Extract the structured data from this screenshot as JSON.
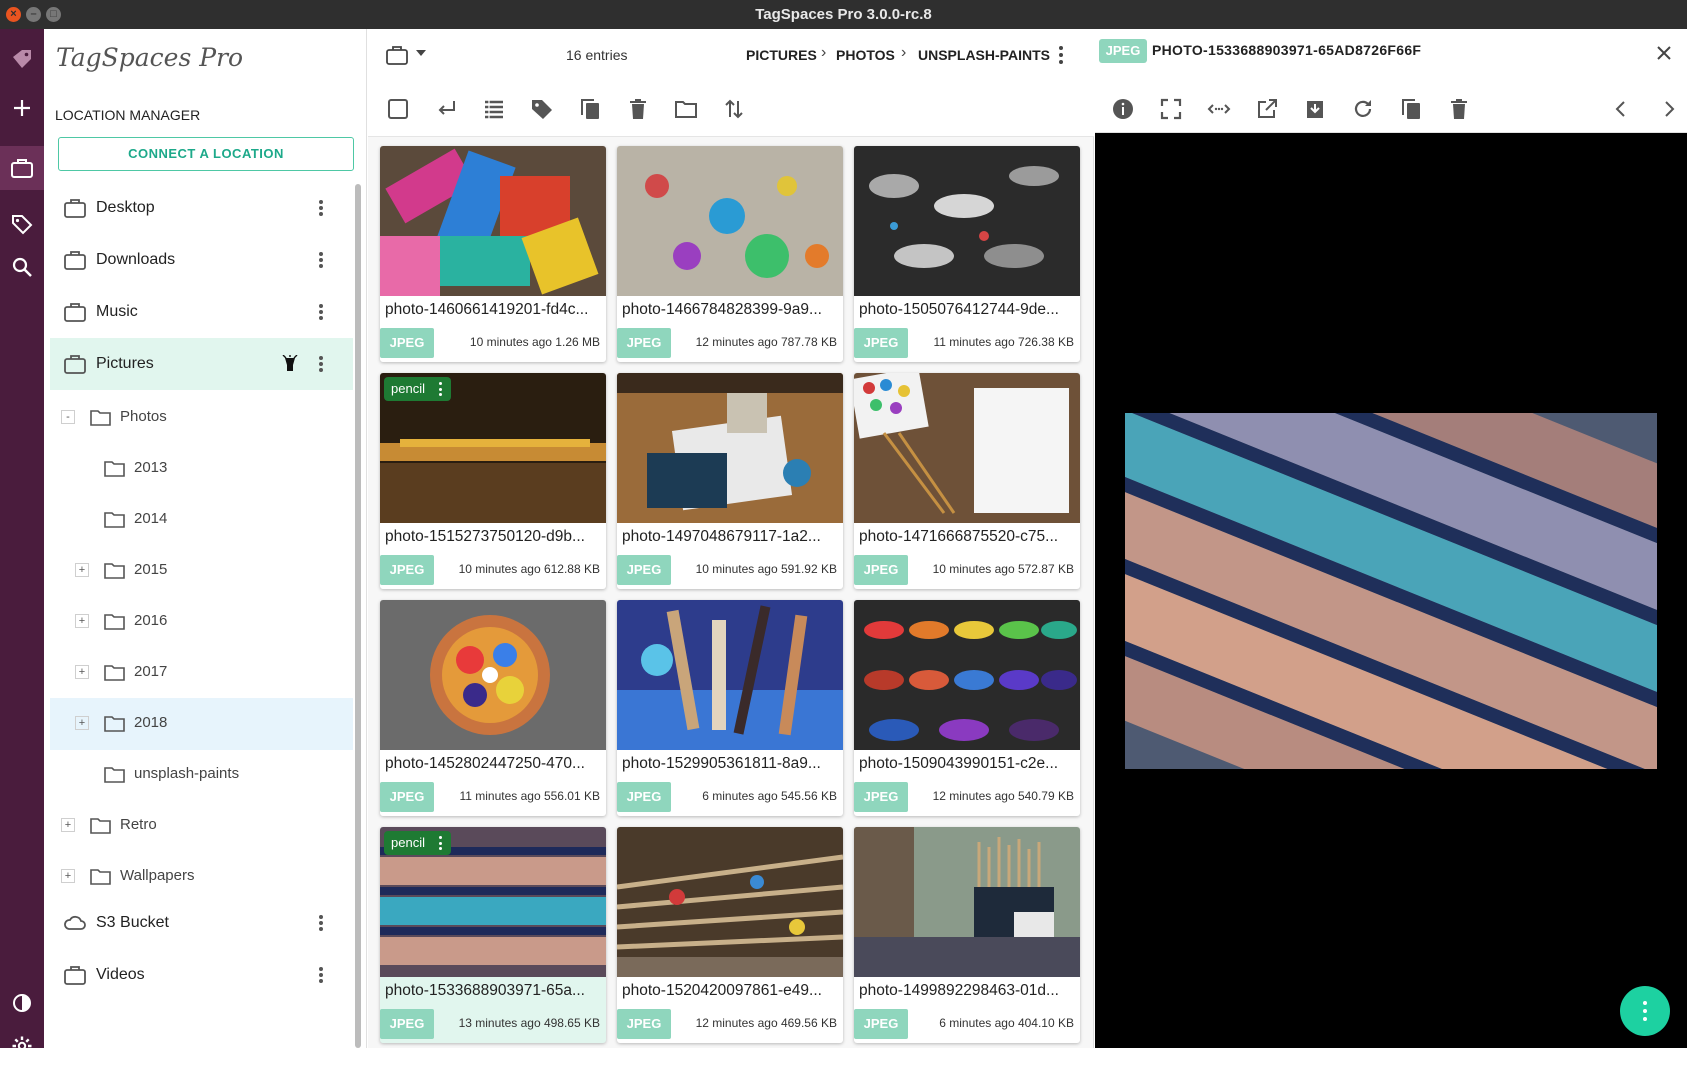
{
  "window": {
    "title": "TagSpaces Pro 3.0.0-rc.8"
  },
  "sidebar": {
    "logo": "TagSpaces Pro",
    "heading": "LOCATION MANAGER",
    "connect_label": "CONNECT A LOCATION",
    "locations": [
      {
        "label": "Desktop"
      },
      {
        "label": "Downloads"
      },
      {
        "label": "Music"
      },
      {
        "label": "Pictures"
      }
    ],
    "tree": [
      {
        "label": "Photos",
        "expander": "-"
      },
      {
        "label": "2013",
        "expander": ""
      },
      {
        "label": "2014",
        "expander": ""
      },
      {
        "label": "2015",
        "expander": "+"
      },
      {
        "label": "2016",
        "expander": "+"
      },
      {
        "label": "2017",
        "expander": "+"
      },
      {
        "label": "2018",
        "expander": "+"
      },
      {
        "label": "unsplash-paints",
        "expander": ""
      },
      {
        "label": "Retro",
        "expander": "+"
      },
      {
        "label": "Wallpapers",
        "expander": "+"
      }
    ],
    "bottom_locations": [
      {
        "label": "S3 Bucket"
      },
      {
        "label": "Videos"
      }
    ]
  },
  "main": {
    "entries": "16 entries",
    "breadcrumb": [
      "PICTURES",
      "PHOTOS",
      "UNSPLASH-PAINTS"
    ],
    "files": [
      {
        "name": "photo-1460661419201-fd4c...",
        "ext": "JPEG",
        "meta": "10 minutes ago 1.26 MB",
        "tag": ""
      },
      {
        "name": "photo-1466784828399-9a9...",
        "ext": "JPEG",
        "meta": "12 minutes ago 787.78 KB",
        "tag": ""
      },
      {
        "name": "photo-1505076412744-9de...",
        "ext": "JPEG",
        "meta": "11 minutes ago 726.38 KB",
        "tag": ""
      },
      {
        "name": "photo-1515273750120-d9b...",
        "ext": "JPEG",
        "meta": "10 minutes ago 612.88 KB",
        "tag": "pencil"
      },
      {
        "name": "photo-1497048679117-1a2...",
        "ext": "JPEG",
        "meta": "10 minutes ago 591.92 KB",
        "tag": ""
      },
      {
        "name": "photo-1471666875520-c75...",
        "ext": "JPEG",
        "meta": "10 minutes ago 572.87 KB",
        "tag": ""
      },
      {
        "name": "photo-1452802447250-470...",
        "ext": "JPEG",
        "meta": "11 minutes ago 556.01 KB",
        "tag": ""
      },
      {
        "name": "photo-1529905361811-8a9...",
        "ext": "JPEG",
        "meta": "6 minutes ago 545.56 KB",
        "tag": ""
      },
      {
        "name": "photo-1509043990151-c2e...",
        "ext": "JPEG",
        "meta": "12 minutes ago 540.79 KB",
        "tag": ""
      },
      {
        "name": "photo-1533688903971-65a...",
        "ext": "JPEG",
        "meta": "13 minutes ago 498.65 KB",
        "tag": "pencil"
      },
      {
        "name": "photo-1520420097861-e49...",
        "ext": "JPEG",
        "meta": "12 minutes ago 469.56 KB",
        "tag": ""
      },
      {
        "name": "photo-1499892298463-01d...",
        "ext": "JPEG",
        "meta": "6 minutes ago 404.10 KB",
        "tag": ""
      }
    ]
  },
  "viewer": {
    "badge": "JPEG",
    "title": "PHOTO-1533688903971-65AD8726F66F"
  },
  "colors": {
    "accent": "#1dd1a1",
    "rail": "#4a1c3d",
    "tag": "#1e7a33",
    "ext_badge": "#8fd6bd"
  }
}
